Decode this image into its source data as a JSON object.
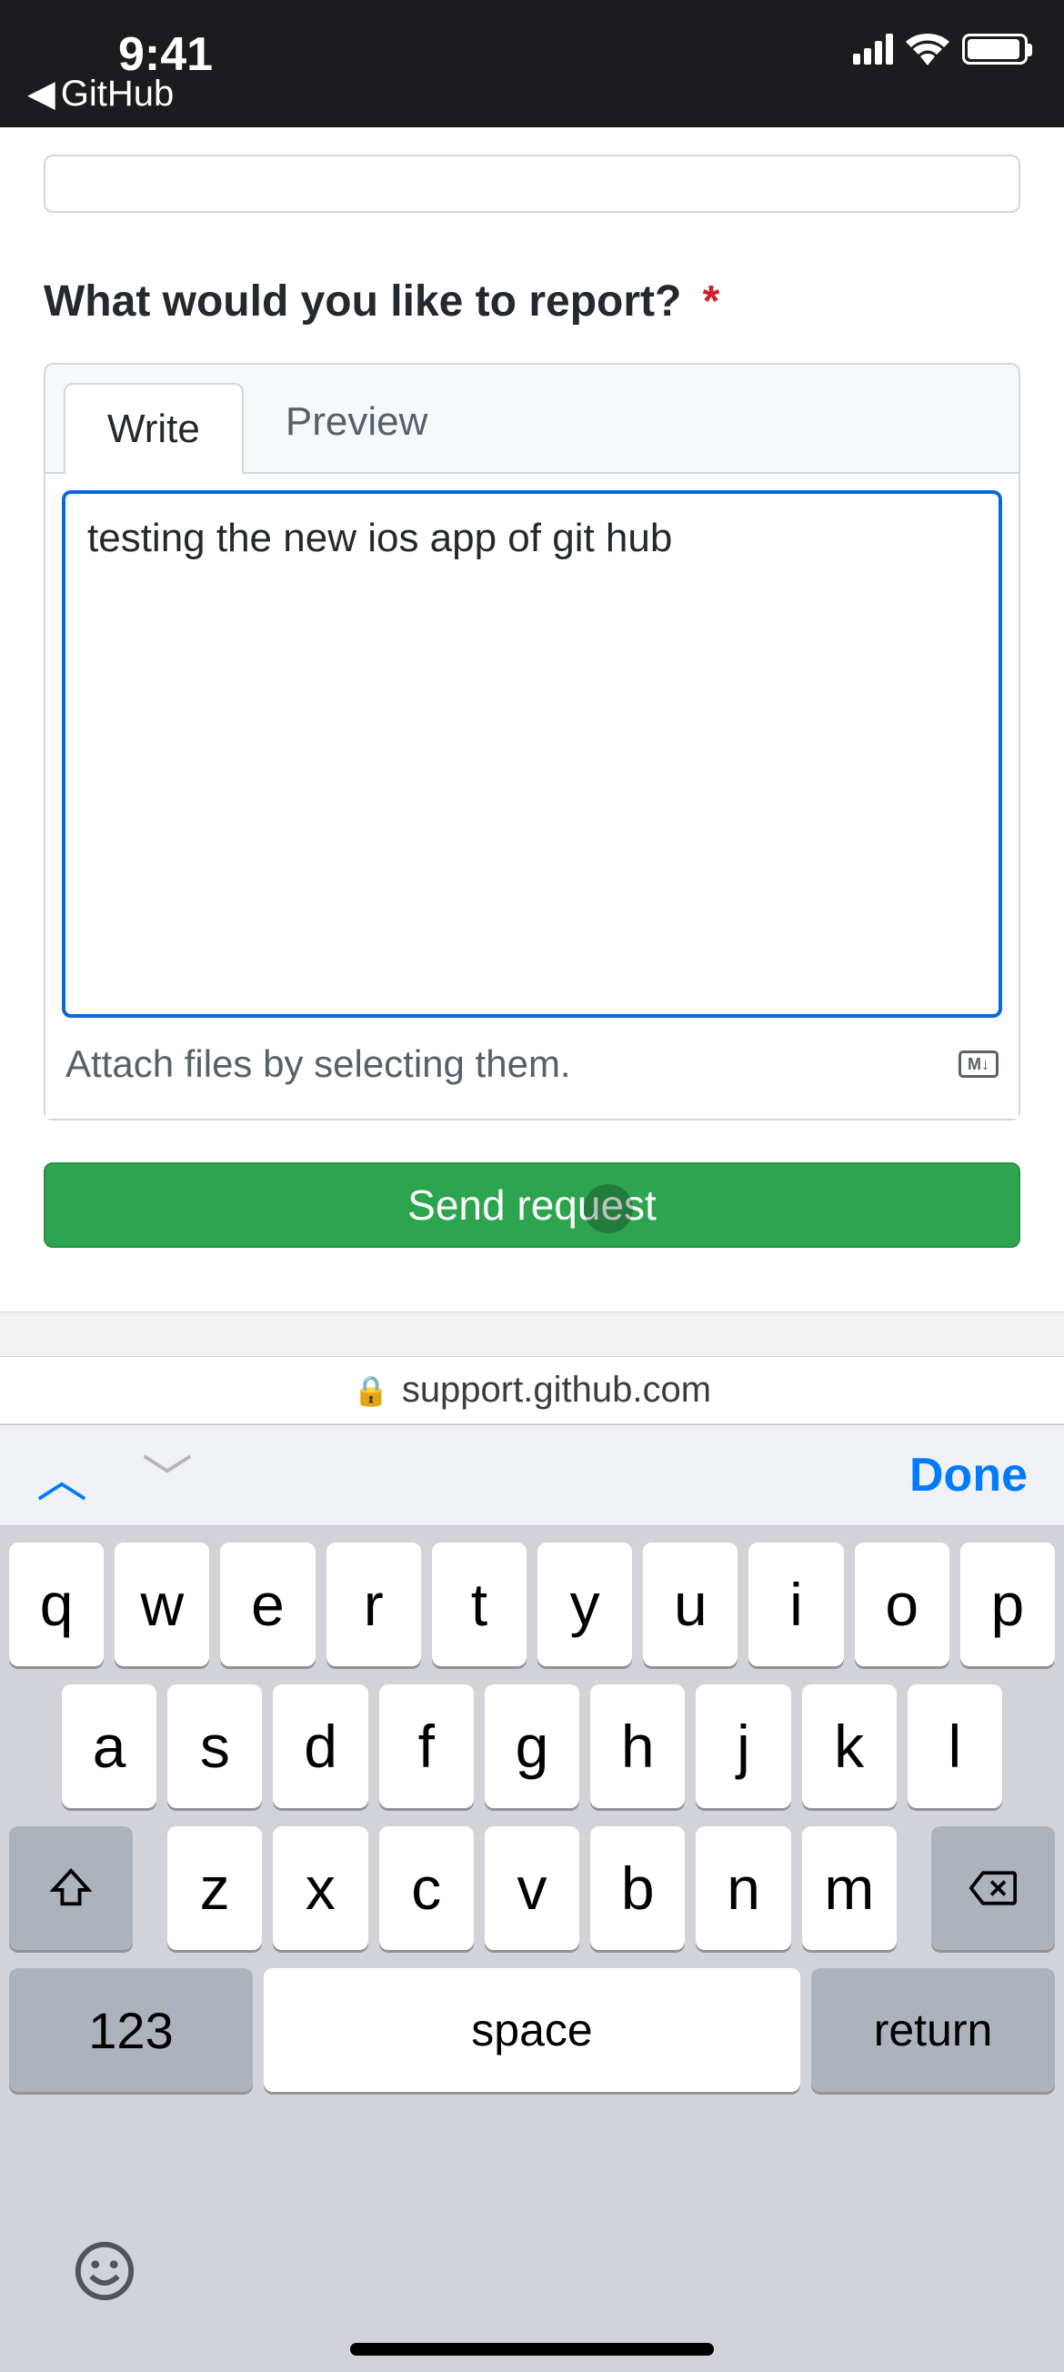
{
  "status_bar": {
    "time": "9:41",
    "back_app_label": "GitHub"
  },
  "form": {
    "question_label": "What would you like to report?",
    "required_marker": "*",
    "tabs": {
      "write": "Write",
      "preview": "Preview"
    },
    "textarea_value": "testing the new ios app of git hub",
    "attach_hint": "Attach files by selecting them.",
    "markdown_badge": "M↓",
    "submit_label": "Send request"
  },
  "browser": {
    "url": "support.github.com"
  },
  "keyboard": {
    "done_label": "Done",
    "row1": [
      "q",
      "w",
      "e",
      "r",
      "t",
      "y",
      "u",
      "i",
      "o",
      "p"
    ],
    "row2": [
      "a",
      "s",
      "d",
      "f",
      "g",
      "h",
      "j",
      "k",
      "l"
    ],
    "row3": [
      "z",
      "x",
      "c",
      "v",
      "b",
      "n",
      "m"
    ],
    "numbers_label": "123",
    "space_label": "space",
    "return_label": "return"
  }
}
